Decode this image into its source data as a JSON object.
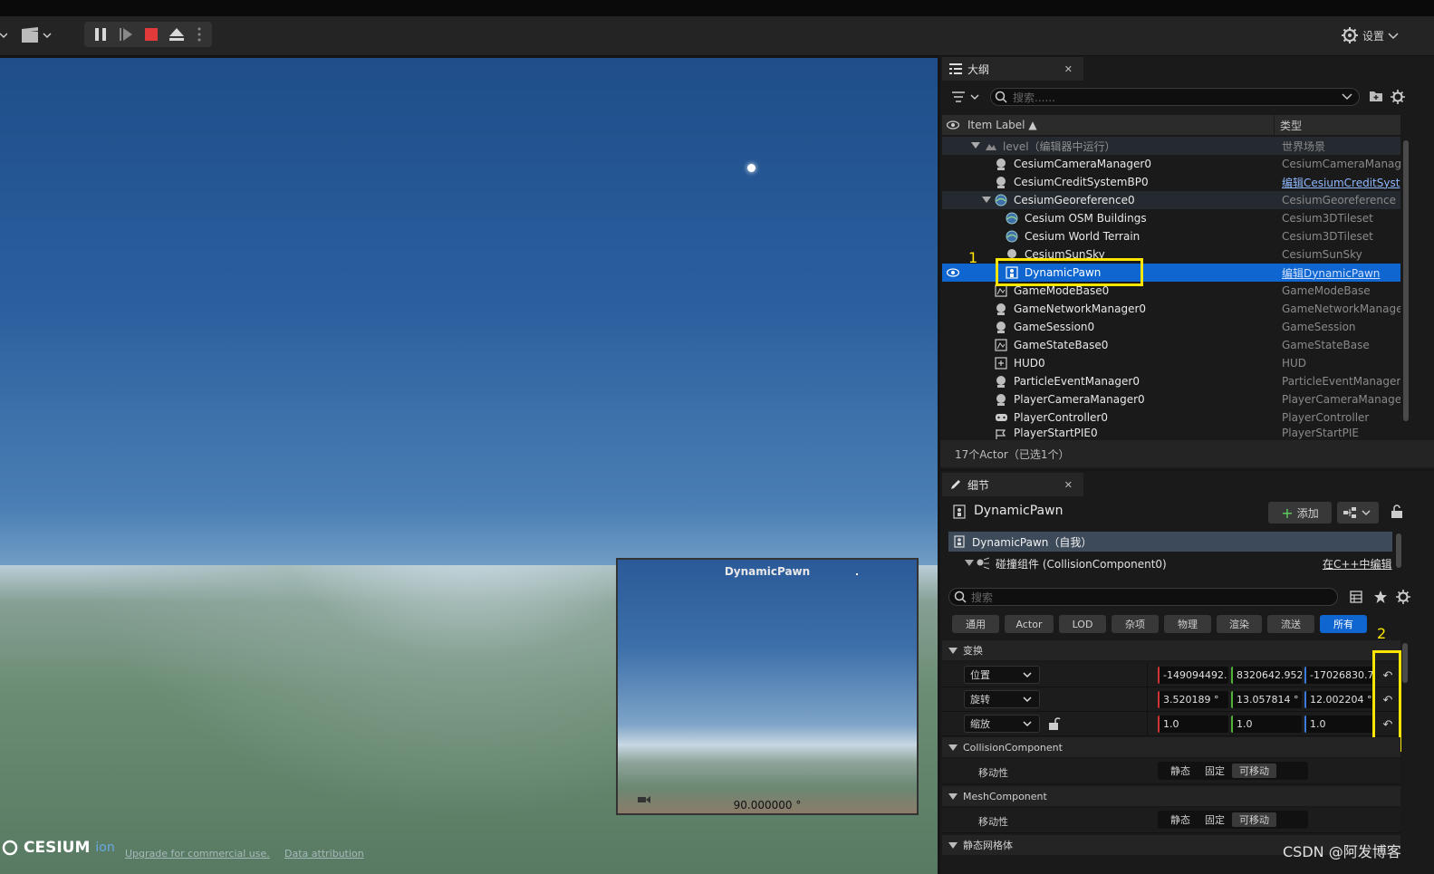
{
  "toolbar": {
    "settings_label": "设置"
  },
  "viewport": {
    "pip_title": "DynamicPawn",
    "pip_angle": "90.000000 °",
    "cesium_brand": "CESIUM",
    "cesium_ion": "ion",
    "credit_upgrade": "Upgrade for commercial use.",
    "credit_attr": "Data attribution"
  },
  "outliner": {
    "tab_label": "大纲",
    "search_placeholder": "搜索......",
    "col_label": "Item Label ▲",
    "col_type": "类型",
    "rows": [
      {
        "label": "level（编辑器中运行）",
        "type": "世界场景"
      },
      {
        "label": "CesiumCameraManager0",
        "type": "CesiumCameraManage"
      },
      {
        "label": "CesiumCreditSystemBP0",
        "type": "编辑CesiumCreditSyst"
      },
      {
        "label": "CesiumGeoreference0",
        "type": "CesiumGeoreference"
      },
      {
        "label": "Cesium OSM Buildings",
        "type": "Cesium3DTileset"
      },
      {
        "label": "Cesium World Terrain",
        "type": "Cesium3DTileset"
      },
      {
        "label": "CesiumSunSky",
        "type": "CesiumSunSky"
      },
      {
        "label": "DynamicPawn",
        "type": "编辑DynamicPawn"
      },
      {
        "label": "GameModeBase0",
        "type": "GameModeBase"
      },
      {
        "label": "GameNetworkManager0",
        "type": "GameNetworkManager"
      },
      {
        "label": "GameSession0",
        "type": "GameSession"
      },
      {
        "label": "GameStateBase0",
        "type": "GameStateBase"
      },
      {
        "label": "HUD0",
        "type": "HUD"
      },
      {
        "label": "ParticleEventManager0",
        "type": "ParticleEventManager"
      },
      {
        "label": "PlayerCameraManager0",
        "type": "PlayerCameraManager"
      },
      {
        "label": "PlayerController0",
        "type": "PlayerController"
      },
      {
        "label": "PlayerStartPIE0",
        "type": "PlayerStartPIE"
      }
    ],
    "status": "17个Actor（已选1个）",
    "anno1": "1"
  },
  "details": {
    "tab_label": "细节",
    "actor_name": "DynamicPawn",
    "add_label": "添加",
    "self_label": "DynamicPawn（自我）",
    "component_label": "碰撞组件 (CollisionComponent0)",
    "edit_cpp": "在C++中编辑",
    "search_placeholder": "搜索",
    "filters": [
      "通用",
      "Actor",
      "LOD",
      "杂项",
      "物理",
      "渲染",
      "流送",
      "所有"
    ],
    "section_transform": "变换",
    "location": {
      "label": "位置",
      "x": "-149094492.",
      "y": "8320642.952",
      "z": "-17026830.7"
    },
    "rotation": {
      "label": "旋转",
      "x": "3.520189 °",
      "y": "13.057814 °",
      "z": "12.002204 °"
    },
    "scale": {
      "label": "缩放",
      "x": "1.0",
      "y": "1.0",
      "z": "1.0"
    },
    "section_collision": "CollisionComponent",
    "section_mesh": "MeshComponent",
    "section_static_mesh": "静态网格体",
    "mobility_label": "移动性",
    "mobility_options": [
      "静态",
      "固定",
      "可移动"
    ],
    "anno2": "2"
  },
  "watermark": "CSDN @阿发博客",
  "colors": {
    "selection": "#0f66d0",
    "accent_yellow": "#ffe600",
    "active_filter": "#0f66d0"
  }
}
